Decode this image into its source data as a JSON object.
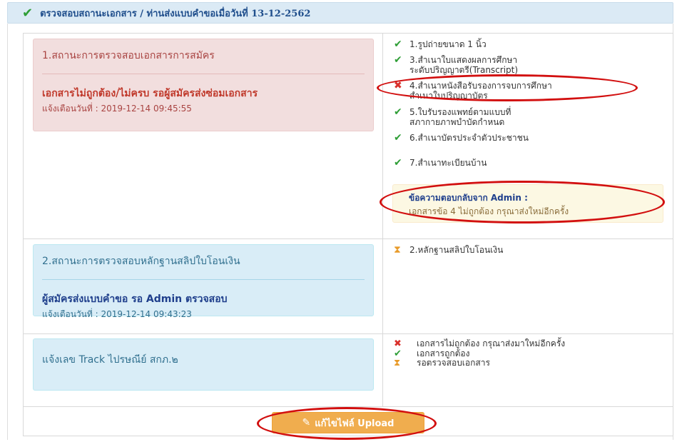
{
  "header": {
    "check_icon": "check-icon",
    "title": "ตรวจสอบสถานะเอกสาร / ท่านส่งแบบคำขอเมื่อวันที่ 13-12-2562"
  },
  "panels": {
    "documents": {
      "title": "1.สถานะการตรวจสอบเอกสารการสมัคร",
      "status": "เอกสารไม่ถูกต้อง/ไม่ครบ รอผู้สมัครส่งซ่อมเอกสาร",
      "date": "แจ้งเตือนวันที่ : 2019-12-14 09:45:55"
    },
    "payment": {
      "title": "2.สถานะการตรวจสอบหลักฐานสลิปใบโอนเงิน",
      "status": "ผู้สมัครส่งแบบคำขอ รอ Admin ตรวจสอบ",
      "date": "แจ้งเตือนวันที่ : 2019-12-14 09:43:23"
    },
    "track": {
      "title": "แจ้งเลข Track ไปรษณีย์ สกภ.๒"
    }
  },
  "documents": [
    {
      "status": "ok",
      "icon": "check-icon",
      "lines": [
        "1.รูปถ่ายขนาด 1 นิ้ว"
      ]
    },
    {
      "status": "ok",
      "icon": "check-icon",
      "lines": [
        "3.สำเนาใบแสดงผลการศึกษา",
        "ระดับปริญญาตรี(Transcript)"
      ]
    },
    {
      "status": "bad",
      "icon": "cross-icon",
      "lines": [
        "4.สำเนาหนังสือรับรองการจบการศึกษา",
        "สำเนาใบปริญญาบัตร"
      ]
    },
    {
      "status": "ok",
      "icon": "check-icon",
      "lines": [
        "5.ใบรับรองแพทย์ตามแบบที่",
        "สภากายภาพบำบัดกำหนด"
      ]
    },
    {
      "status": "ok",
      "icon": "check-icon",
      "lines": [
        "6.สำเนาบัตรประจำตัวประชาชน"
      ]
    },
    {
      "status": "ok",
      "icon": "check-icon",
      "lines": [
        "7.สำเนาทะเบียนบ้าน"
      ]
    }
  ],
  "admin_reply": {
    "title": "ข้อความตอบกลับจาก Admin :",
    "text": "เอกสารข้อ 4 ไม่ถูกต้อง กรุณาส่งใหม่อีกครั้ง"
  },
  "payment_item": {
    "status": "wait",
    "icon": "hourglass-icon",
    "label": "2.หลักฐานสลิปใบโอนเงิน"
  },
  "legend": [
    {
      "status": "bad",
      "icon": "cross-icon",
      "label": "เอกสารไม่ถูกต้อง กรุณาส่งมาใหม่อีกครั้ง"
    },
    {
      "status": "ok",
      "icon": "check-icon",
      "label": "เอกสารถูกต้อง"
    },
    {
      "status": "wait",
      "icon": "hourglass-icon",
      "label": "รอตรวจสอบเอกสาร"
    }
  ],
  "upload_button": {
    "icon": "edit-icon",
    "label": "แก้ไขไฟล์ Upload"
  },
  "colors": {
    "annotation": "#d20f0f",
    "ok": "#2e9e36",
    "bad": "#d9302b",
    "wait": "#e89b2a",
    "button": "#f0ad4e"
  }
}
